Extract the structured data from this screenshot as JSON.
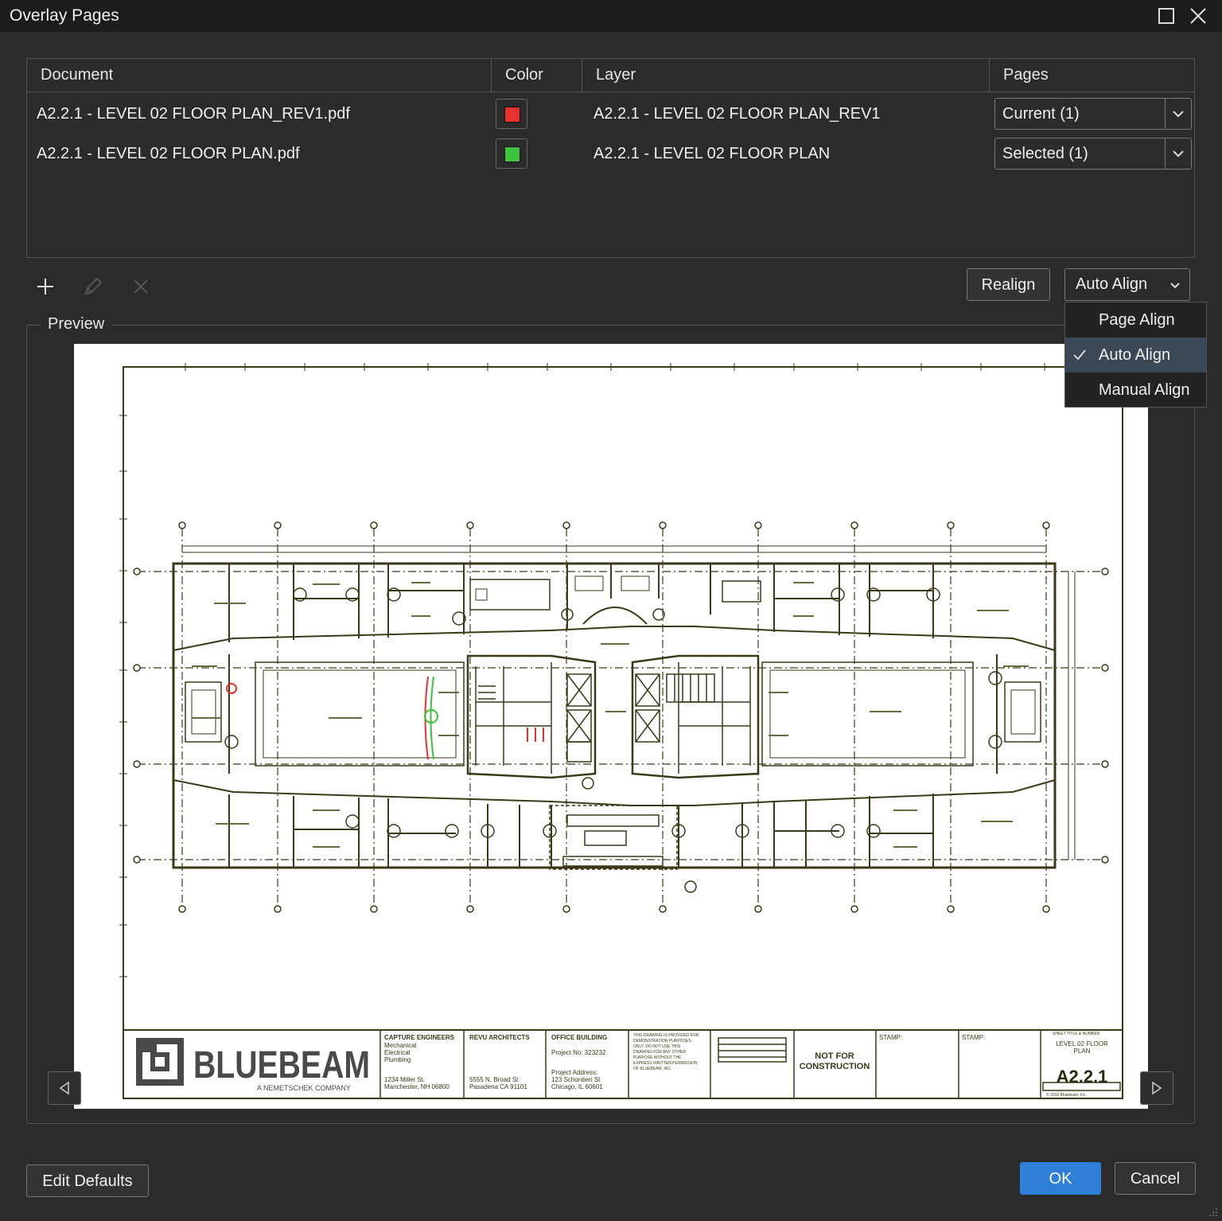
{
  "window": {
    "title": "Overlay Pages"
  },
  "table": {
    "headers": {
      "document": "Document",
      "color": "Color",
      "layer": "Layer",
      "pages": "Pages"
    },
    "rows": [
      {
        "document": "A2.2.1 - LEVEL 02 FLOOR PLAN_REV1.pdf",
        "color": "#e8312a",
        "layer": "A2.2.1 - LEVEL 02 FLOOR PLAN_REV1",
        "pages": "Current (1)"
      },
      {
        "document": "A2.2.1 - LEVEL 02 FLOOR PLAN.pdf",
        "color": "#3cc23c",
        "layer": "A2.2.1 - LEVEL 02 FLOOR PLAN",
        "pages": "Selected (1)"
      }
    ]
  },
  "toolbar": {
    "realign_label": "Realign",
    "align_selected": "Auto Align"
  },
  "align_menu": {
    "items": [
      "Page Align",
      "Auto Align",
      "Manual Align"
    ],
    "selected": "Auto Align"
  },
  "preview": {
    "label": "Preview",
    "title_block": {
      "logo": "BLUEBEAM",
      "tagline": "A NEMETSCHEK COMPANY",
      "engineers": "CAPTURE ENGINEERS",
      "engineers_lines": [
        "Mechanical",
        "Electrical",
        "Plumbing"
      ],
      "engineers_address": [
        "1234 Miller St.",
        "Manchester, NH 06800"
      ],
      "architects": "REVU ARCHITECTS",
      "architects_address": [
        "5555 N. Broad St",
        "Pasadena CA 91101"
      ],
      "project": "OFFICE BUILDING",
      "project_no": "Project No: 323232",
      "project_address": [
        "Project Address:",
        "123 Schonberi St",
        "Chicago, IL 60601"
      ],
      "disclaimer": [
        "THIS DRAWING IS PROVIDED FOR",
        "DEMONSTRATION PURPOSES",
        "ONLY. DO NOT USE THIS",
        "DRAWING FOR ANY OTHER",
        "PURPOSE WITHOUT THE",
        "EXPRESS WRITTEN PERMISSION",
        "OF BLUEBEAM, INC."
      ],
      "not_for_construction": [
        "NOT FOR",
        "CONSTRUCTION"
      ],
      "stamp1": "STAMP:",
      "stamp2": "STAMP:",
      "sheet_label": "SHEET TITLE & NUMBER",
      "sheet_title": [
        "LEVEL 02 FLOOR",
        "PLAN"
      ],
      "sheet_number": "A2.2.1",
      "copyright": "© 2016 Bluebeam, Inc."
    }
  },
  "footer": {
    "edit_defaults": "Edit Defaults",
    "ok": "OK",
    "cancel": "Cancel"
  }
}
